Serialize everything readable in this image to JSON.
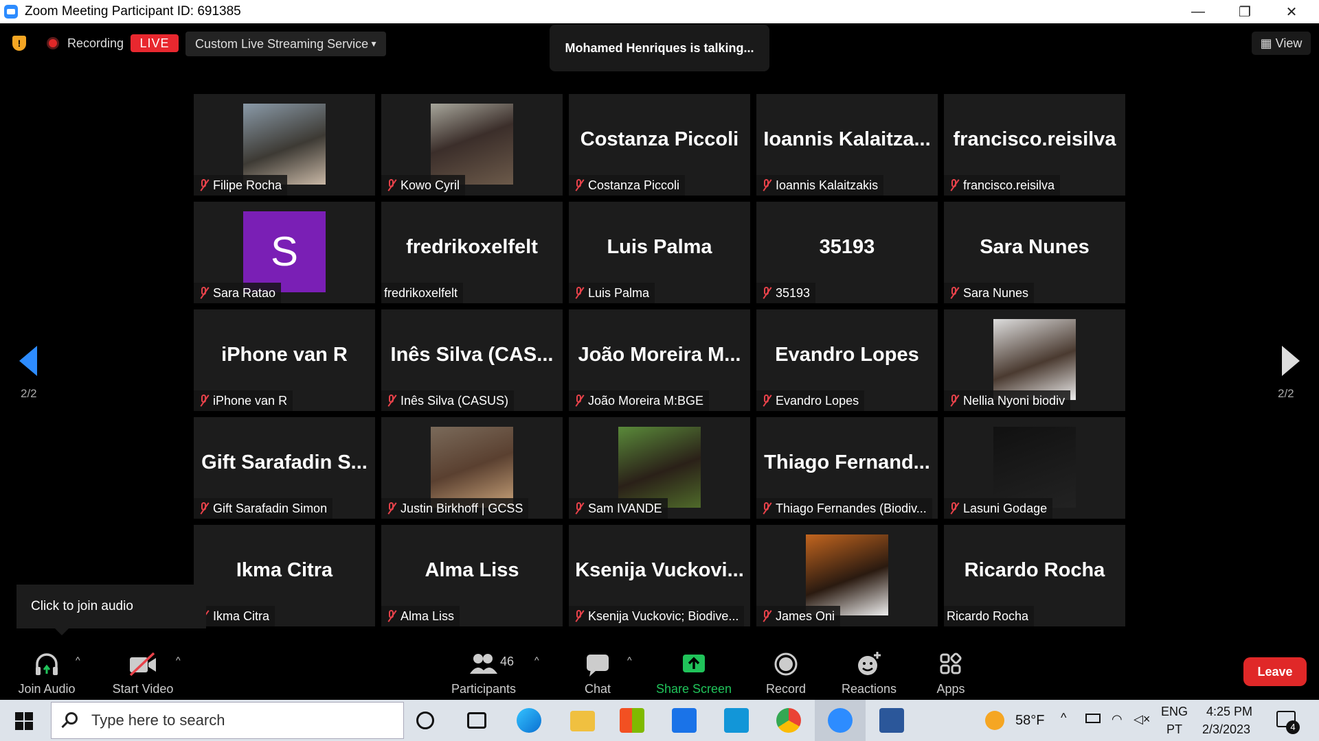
{
  "window": {
    "title": "Zoom Meeting Participant ID: 691385",
    "minimize": "—",
    "restore": "❐",
    "close": "✕"
  },
  "topbar": {
    "shield": "!",
    "recording": "Recording",
    "live": "LIVE",
    "stream_service": "Custom Live Streaming Service",
    "stream_caret": "▼",
    "talking": "Mohamed Henriques is talking...",
    "view": "▦ View"
  },
  "pagination": {
    "left": "2/2",
    "right": "2/2"
  },
  "participants": [
    {
      "big": "",
      "label": "Filipe Rocha",
      "muted": true,
      "photo": "p1"
    },
    {
      "big": "",
      "label": "Kowo Cyril",
      "muted": true,
      "photo": "p2"
    },
    {
      "big": "Costanza Piccoli",
      "label": "Costanza Piccoli",
      "muted": true
    },
    {
      "big": "Ioannis Kalaitza...",
      "label": "Ioannis Kalaitzakis",
      "muted": true
    },
    {
      "big": "francisco.reisilva",
      "label": "francisco.reisilva",
      "muted": true
    },
    {
      "big": "",
      "label": "Sara Ratao",
      "muted": true,
      "letter": "S"
    },
    {
      "big": "fredrikoxelfelt",
      "label": "fredrikoxelfelt",
      "muted": false
    },
    {
      "big": "Luis Palma",
      "label": "Luis Palma",
      "muted": true
    },
    {
      "big": "35193",
      "label": "35193",
      "muted": true
    },
    {
      "big": "Sara Nunes",
      "label": "Sara Nunes",
      "muted": true
    },
    {
      "big": "iPhone van R",
      "label": "iPhone van R",
      "muted": true
    },
    {
      "big": "Inês Silva (CAS...",
      "label": "Inês Silva (CASUS)",
      "muted": true
    },
    {
      "big": "João Moreira M...",
      "label": "João Moreira M:BGE",
      "muted": true
    },
    {
      "big": "Evandro Lopes",
      "label": "Evandro Lopes",
      "muted": true
    },
    {
      "big": "",
      "label": "Nellia Nyoni biodiv",
      "muted": true,
      "photo": "p3"
    },
    {
      "big": "Gift Sarafadin S...",
      "label": "Gift Sarafadin Simon",
      "muted": true
    },
    {
      "big": "",
      "label": "Justin Birkhoff | GCSS",
      "muted": true,
      "photo": "p4"
    },
    {
      "big": "",
      "label": "Sam IVANDE",
      "muted": true,
      "photo": "p5"
    },
    {
      "big": "Thiago Fernand...",
      "label": "Thiago Fernandes (Biodiv...",
      "muted": true
    },
    {
      "big": "",
      "label": "Lasuni Godage",
      "muted": true,
      "photo": "p6"
    },
    {
      "big": "Ikma Citra",
      "label": "Ikma Citra",
      "muted": true
    },
    {
      "big": "Alma Liss",
      "label": "Alma Liss",
      "muted": true
    },
    {
      "big": "Ksenija Vuckovi...",
      "label": "Ksenija Vuckovic; Biodive...",
      "muted": true
    },
    {
      "big": "",
      "label": "James Oni",
      "muted": true,
      "photo": "p7"
    },
    {
      "big": "Ricardo Rocha",
      "label": "Ricardo Rocha",
      "muted": false
    }
  ],
  "tooltip": "Click to join audio",
  "toolbar": {
    "join_audio": "Join Audio",
    "start_video": "Start Video",
    "participants": "Participants",
    "participants_count": "46",
    "chat": "Chat",
    "share_screen": "Share Screen",
    "record": "Record",
    "reactions": "Reactions",
    "apps": "Apps",
    "leave": "Leave",
    "caret": "^"
  },
  "taskbar": {
    "search_placeholder": "Type here to search",
    "weather": "58°F",
    "lang1": "ENG",
    "lang2": "PT",
    "time": "4:25 PM",
    "date": "2/3/2023",
    "notifications": "4"
  },
  "colors": {
    "accent": "#2d8cff",
    "live_red": "#e8282f",
    "muted_red": "#e8424a",
    "share_green": "#20c35a",
    "leave_red": "#e02828"
  }
}
